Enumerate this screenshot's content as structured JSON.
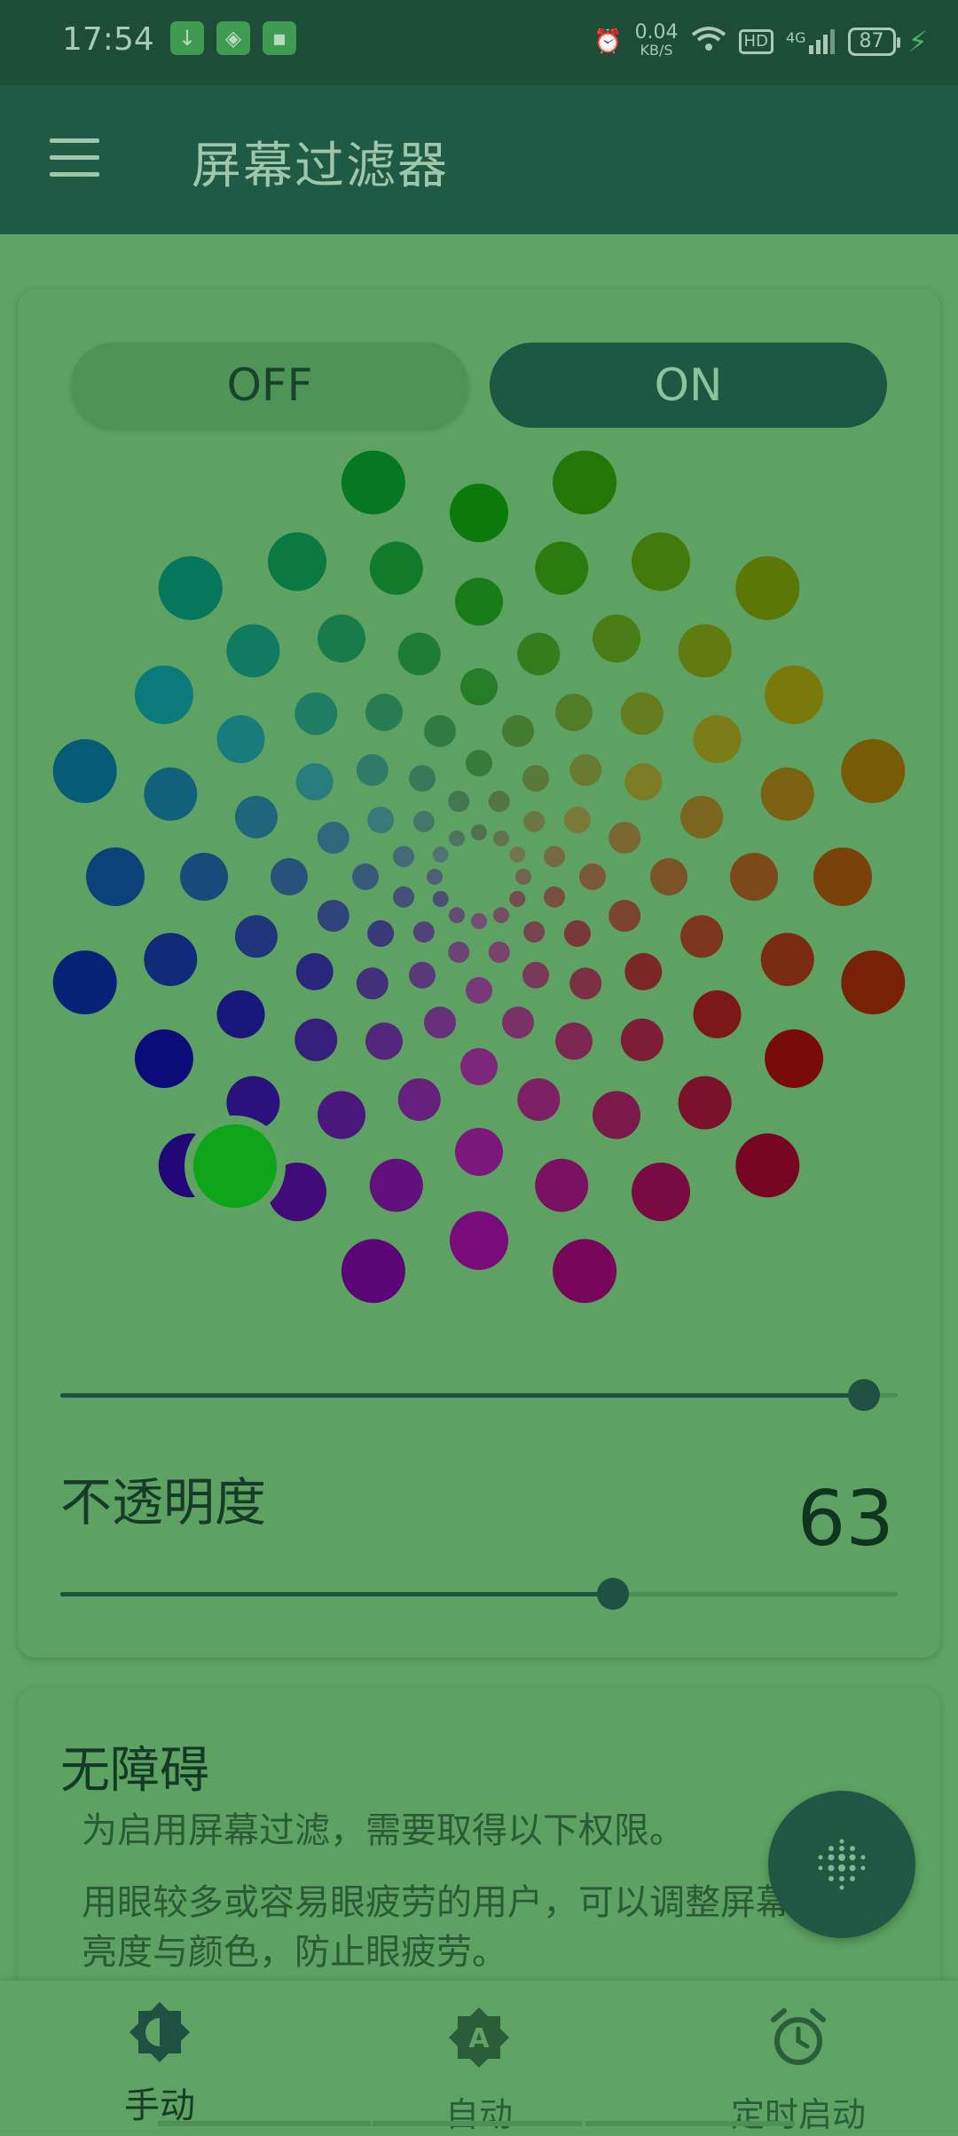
{
  "status_bar": {
    "time": "17:54",
    "net_speed": "0.04",
    "net_unit": "KB/S",
    "hd": "HD",
    "signal": "4G",
    "battery": "87"
  },
  "app_bar": {
    "title": "屏幕过滤器"
  },
  "toggle": {
    "off_label": "OFF",
    "on_label": "ON",
    "selected": "ON"
  },
  "color_slider": {
    "value_fraction": 0.96
  },
  "opacity": {
    "label": "不透明度",
    "value": "63",
    "fraction": 0.66
  },
  "accessibility": {
    "title": "无障碍",
    "line1": "为启用屏幕过滤，需要取得以下权限。",
    "line2": "用眼较多或容易眼疲劳的用户，可以调整屏幕亮度与颜色，防止眼疲劳。"
  },
  "bottom_nav": {
    "items": [
      {
        "label": "手动",
        "icon": "brightness-icon",
        "active": true
      },
      {
        "label": "自动",
        "icon": "auto-brightness-icon",
        "active": false
      },
      {
        "label": "定时启动",
        "icon": "alarm-icon",
        "active": false
      }
    ]
  },
  "colors": {
    "accent": "#1f5644",
    "background": "#5ea363",
    "status_bar": "#1d4d36"
  }
}
